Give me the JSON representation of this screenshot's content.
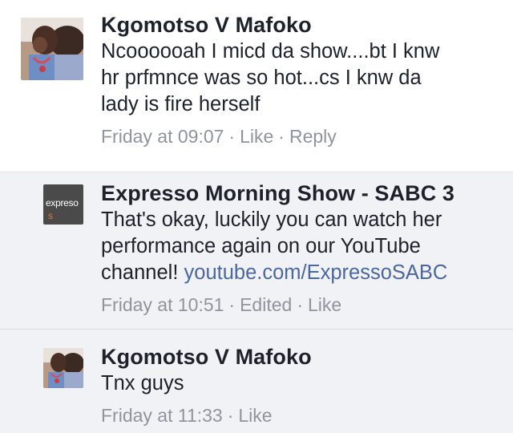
{
  "comments": [
    {
      "author": "Kgomotso V Mafoko",
      "lines": [
        "Ncoooooah I micd da show....bt I knw",
        "hr prfmnce was so hot...cs I knw da",
        "lady is fire herself"
      ],
      "timestamp": "Friday at 09:07",
      "actions": [
        "Like",
        "Reply"
      ],
      "avatar_icon": "profile-photo"
    },
    {
      "author": "Expresso Morning Show - SABC 3",
      "lines": [
        "That's okay, luckily you can watch her",
        "performance again on our YouTube",
        "channel!"
      ],
      "link": "youtube.com/ExpressoSABC",
      "timestamp": "Friday at 10:51",
      "edited": "Edited",
      "actions": [
        "Like"
      ],
      "avatar_logo": "expresso",
      "avatar_icon": "expresso-logo"
    },
    {
      "author": "Kgomotso V Mafoko",
      "lines": [
        "Tnx guys"
      ],
      "timestamp": "Friday at 11:33",
      "actions": [
        "Like"
      ],
      "avatar_icon": "profile-photo"
    }
  ],
  "colors": {
    "text": "#1d2129",
    "meta": "#90949c",
    "link": "#4b67a1",
    "reply_bg": "#f1f2f6"
  }
}
